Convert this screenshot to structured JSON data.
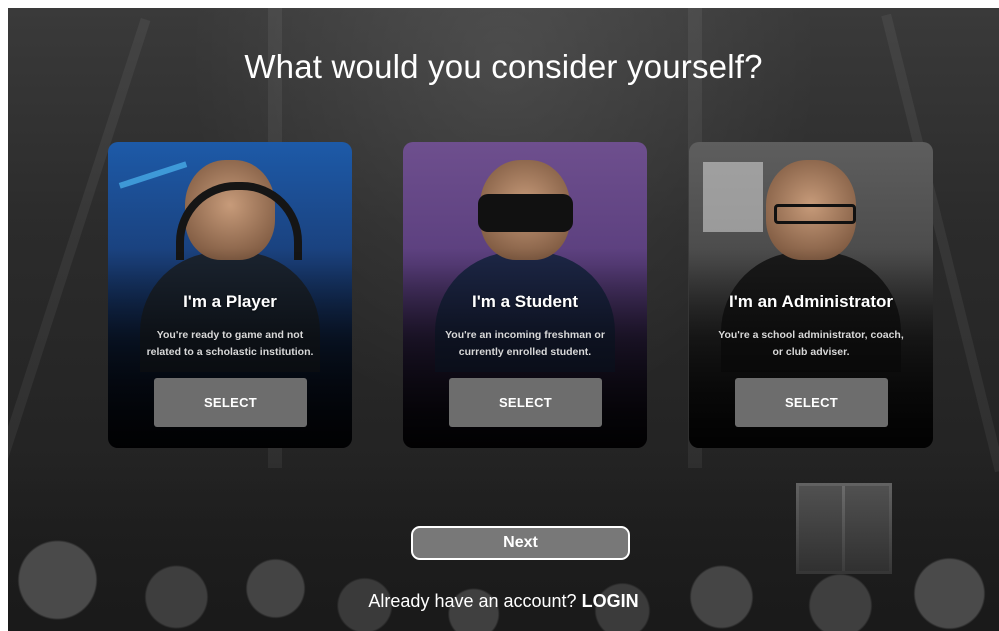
{
  "page": {
    "title": "What would you consider yourself?"
  },
  "cards": [
    {
      "title": "I'm a Player",
      "description_line1": "You're ready to game and not",
      "description_line2": "related to a scholastic institution.",
      "button_label": "SELECT"
    },
    {
      "title": "I'm a Student",
      "description_line1": "You're an incoming freshman or",
      "description_line2": "currently enrolled student.",
      "button_label": "SELECT"
    },
    {
      "title": "I'm an Administrator",
      "description_line1": "You're a school administrator, coach,",
      "description_line2": "or club adviser.",
      "button_label": "SELECT"
    }
  ],
  "footer": {
    "next_label": "Next",
    "login_prompt": "Already have an account?",
    "login_link": "LOGIN"
  },
  "colors": {
    "button_bg": "#6d6d6d",
    "next_bg": "#787878",
    "background": "#2b2b2b"
  }
}
